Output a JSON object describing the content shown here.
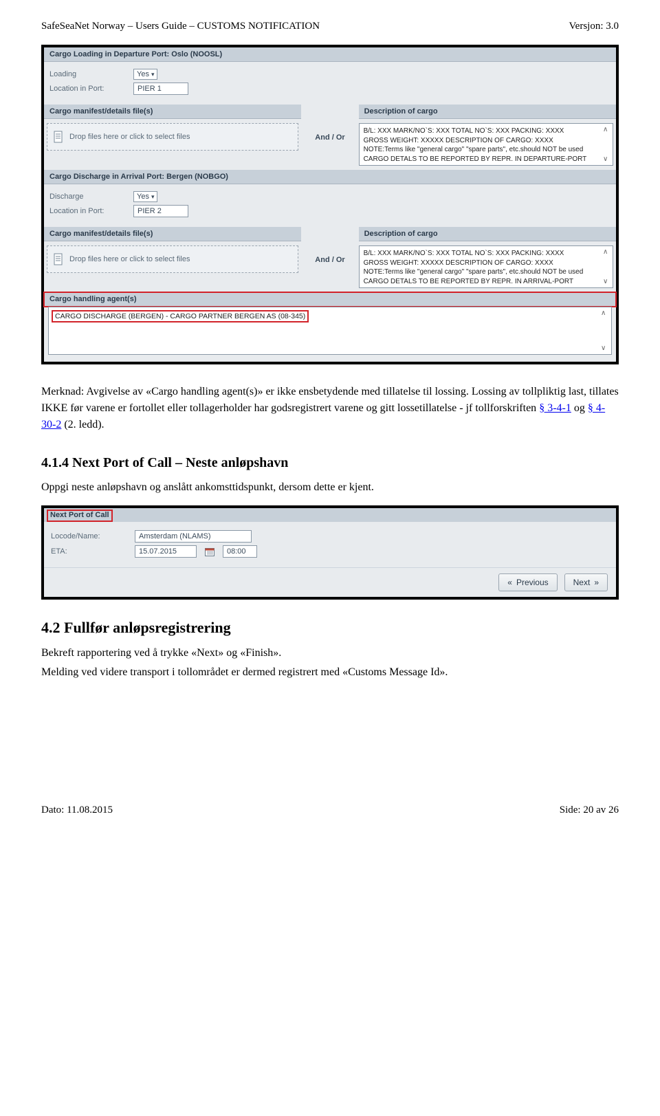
{
  "doc": {
    "title_left": "SafeSeaNet Norway – Users Guide – CUSTOMS NOTIFICATION",
    "title_right": "Versjon: 3.0",
    "footer_left": "Dato: 11.08.2015",
    "footer_right": "Side: 20 av 26"
  },
  "s1": {
    "cargo_loading_head": "Cargo Loading in Departure Port: Oslo (NOOSL)",
    "loading_label": "Loading",
    "loading_value": "Yes",
    "location_label": "Location in Port:",
    "location1_value": "PIER 1",
    "manifest_head": "Cargo manifest/details file(s)",
    "desc_head": "Description of cargo",
    "dropzone_text": "Drop files here or click to select files",
    "and_or": "And / Or",
    "desc1_line1": "B/L: XXX MARK/NO`S: XXX TOTAL NO`S: XXX PACKING: XXXX",
    "desc1_line2": "GROSS WEIGHT: XXXXX DESCRIPTION OF CARGO: XXXX",
    "desc1_line3": "NOTE:Terms like \"general cargo\" \"spare parts\", etc.should NOT be used",
    "desc1_line4": "CARGO DETALS TO BE REPORTED BY REPR. IN DEPARTURE-PORT",
    "cargo_discharge_head": "Cargo Discharge in Arrival Port: Bergen (NOBGO)",
    "discharge_label": "Discharge",
    "discharge_value": "Yes",
    "location2_value": "PIER 2",
    "desc2_line4": "CARGO DETALS TO BE REPORTED BY REPR. IN ARRIVAL-PORT",
    "agent_head": "Cargo handling agent(s)",
    "agent_value": "CARGO DISCHARGE (BERGEN) - CARGO PARTNER BERGEN AS (08-345)"
  },
  "body1": {
    "p1": "Merknad: Avgivelse av «Cargo handling agent(s)» er ikke ensbetydende med tillatelse til lossing. Lossing av tollpliktig last, tillates IKKE før varene er fortollet eller tollagerholder har godsregistrert varene og gitt lossetillatelse - jf tollforskriften ",
    "link1": "§ 3-4-1",
    "p1b": " og ",
    "link2": "§ 4-30-2",
    "p1c": " (2. ledd)."
  },
  "h414": "4.1.4 Next Port of Call – Neste anløpshavn",
  "p414": "Oppgi neste anløpshavn og anslått ankomsttidspunkt, dersom dette er kjent.",
  "s2": {
    "head": "Next Port of Call",
    "locode_label": "Locode/Name:",
    "locode_value": "Amsterdam (NLAMS)",
    "eta_label": "ETA:",
    "eta_date": "15.07.2015",
    "eta_time": "08:00",
    "prev": "Previous",
    "next": "Next"
  },
  "h42": "4.2 Fullfør anløpsregistrering",
  "p42a": "Bekreft rapportering ved å trykke «Next» og «Finish».",
  "p42b": "Melding ved videre transport i tollområdet er dermed registrert med «Customs Message Id»."
}
